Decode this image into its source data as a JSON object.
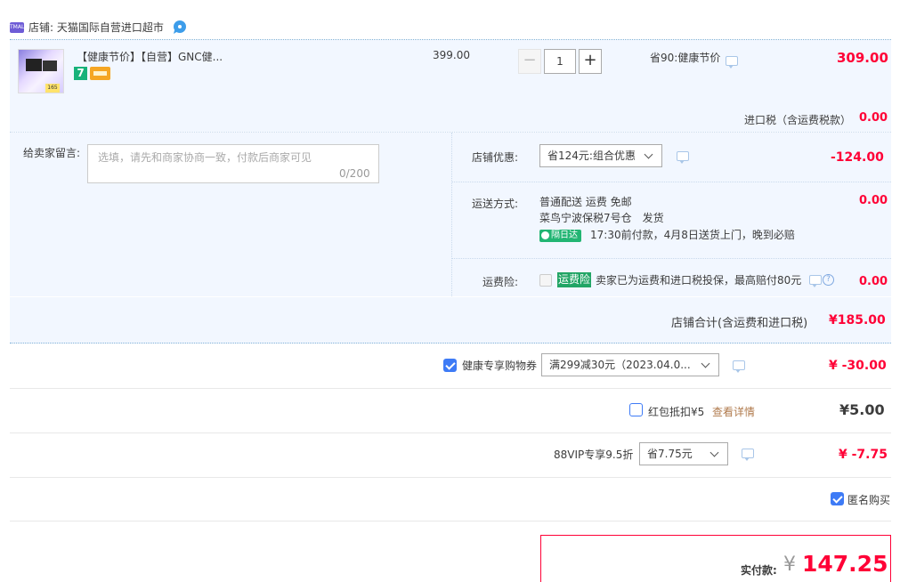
{
  "shop": {
    "badge": "TMALL",
    "name_label": "店铺: 天猫国际自营进口超市"
  },
  "item": {
    "title": "【健康节价】【自营】GNC健...",
    "badge7": "7",
    "unit_price": "399.00",
    "qty_minus": "−",
    "qty": "1",
    "qty_plus": "+",
    "promo": "省90:健康节价",
    "total": "309.00",
    "thumb_tag": "165"
  },
  "tax": {
    "label": "进口税（含运费税款）",
    "value": "0.00"
  },
  "memo": {
    "label": "给卖家留言:",
    "placeholder": "选填，请先和商家协商一致，付款后商家可见",
    "count": "0/200"
  },
  "shop_discount": {
    "label": "店铺优惠:",
    "selected": "省124元:组合优惠",
    "value": "-124.00"
  },
  "shipping": {
    "label": "运送方式:",
    "method": "普通配送 运费 免邮",
    "warehouse": "菜鸟宁波保税7号仓　发货",
    "badge": "隔日达",
    "note": "17:30前付款，4月8日送货上门，晚到必赔",
    "value": "0.00"
  },
  "insurance": {
    "label": "运费险:",
    "badge": "运费险",
    "text": "卖家已为运费和进口税投保，最高赔付80元",
    "value": "0.00"
  },
  "subtotal": {
    "label": "店铺合计(含运费和进口税)",
    "value": "¥185.00"
  },
  "coupon": {
    "label": "健康专享购物券",
    "selected": "满299减30元（2023.04.0...",
    "value": "¥ -30.00"
  },
  "redpacket": {
    "label": "红包抵扣¥5",
    "link": "查看详情",
    "value": "¥5.00"
  },
  "vip": {
    "label": "88VIP专享9.5折",
    "selected": "省7.75元",
    "value": "¥ -7.75"
  },
  "anonymous": {
    "label": "匿名购买"
  },
  "pay": {
    "label": "实付款:",
    "currency": "¥",
    "value": "147.25"
  },
  "colors": {
    "accent_red": "#ff0036",
    "row_bg": "#f2f7ff",
    "check_blue": "#3e7bf6",
    "green": "#22b573"
  }
}
